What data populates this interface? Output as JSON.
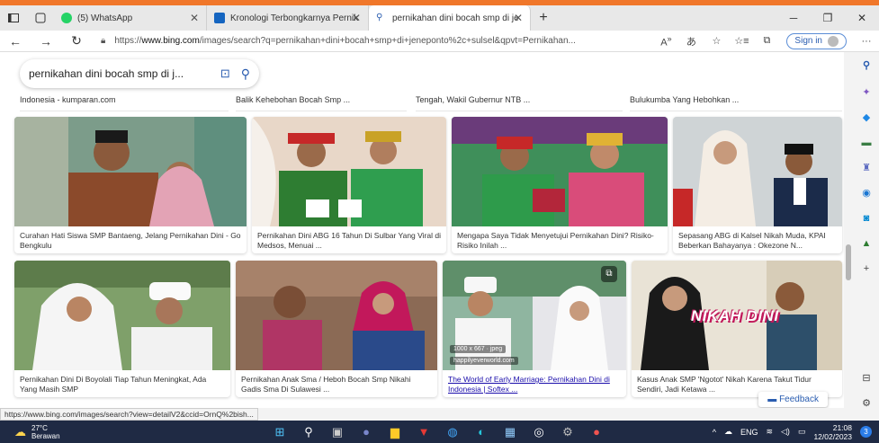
{
  "colors": {
    "accent": "#2a5db0",
    "stripe": "#f0772a",
    "taskbar": "#1f2a44"
  },
  "tabs": [
    {
      "title": "(5) WhatsApp",
      "icon": "whatsapp-icon"
    },
    {
      "title": "Kronologi Terbongkarnya Pernik",
      "icon": "tab-site-icon"
    },
    {
      "title": "pernikahan dini bocah smp di je",
      "icon": "bing-search-icon"
    }
  ],
  "address": {
    "prefix": "https://",
    "domain": "www.bing.com",
    "path": "/images/search?q=pernikahan+dini+bocah+smp+di+jeneponto%2c+sulsel&qpvt=Pernikahan...",
    "signin": "Sign in"
  },
  "search": {
    "query": "pernikahan dini bocah smp di j..."
  },
  "prev_captions": [
    "Indonesia - kumparan.com",
    "Balik Kehebohan Bocah Smp ...",
    "Tengah, Wakil Gubernur NTB ...",
    "Bulukumba Yang Hebohkan ..."
  ],
  "row1": [
    {
      "caption": "Curahan Hati Siswa SMP Bantaeng, Jelang Pernikahan Dini - Go Bengkulu"
    },
    {
      "caption": "Pernikahan Dini ABG 16 Tahun Di Sulbar Yang Viral di Medsos, Menuai ..."
    },
    {
      "caption": "Mengapa Saya Tidak Menyetujui Pernikahan Dini? Risiko-Risiko Inilah ..."
    },
    {
      "caption": "Sepasang ABG di Kalsel Nikah Muda, KPAI Beberkan Bahayanya : Okezone N..."
    }
  ],
  "row2": [
    {
      "caption": "Pernikahan Dini Di Boyolali Tiap Tahun Meningkat, Ada Yang Masih SMP"
    },
    {
      "caption": "Pernikahan Anak Sma / Heboh Bocah Smp Nikahi Gadis Sma Di Sulawesi ..."
    },
    {
      "caption": "The World of Early Marriage: Pernikahan Dini di Indonesia | Softex ...",
      "size": "1000 x 667 · jpeg",
      "source": "happilyeverworld.com"
    },
    {
      "caption": "Kasus Anak SMP 'Ngotot' Nikah Karena Takut Tidur Sendiri, Jadi Ketawa ...",
      "overlay": "NIKAH DINI"
    }
  ],
  "feedback": "Feedback",
  "status_url": "https://www.bing.com/images/search?view=detailV2&ccid=OrnQ%2bish...",
  "weather": {
    "temp": "27°C",
    "desc": "Berawan"
  },
  "tray": {
    "lang": "ENG",
    "time": "21:08",
    "date": "12/02/2023",
    "notifications": "3"
  }
}
